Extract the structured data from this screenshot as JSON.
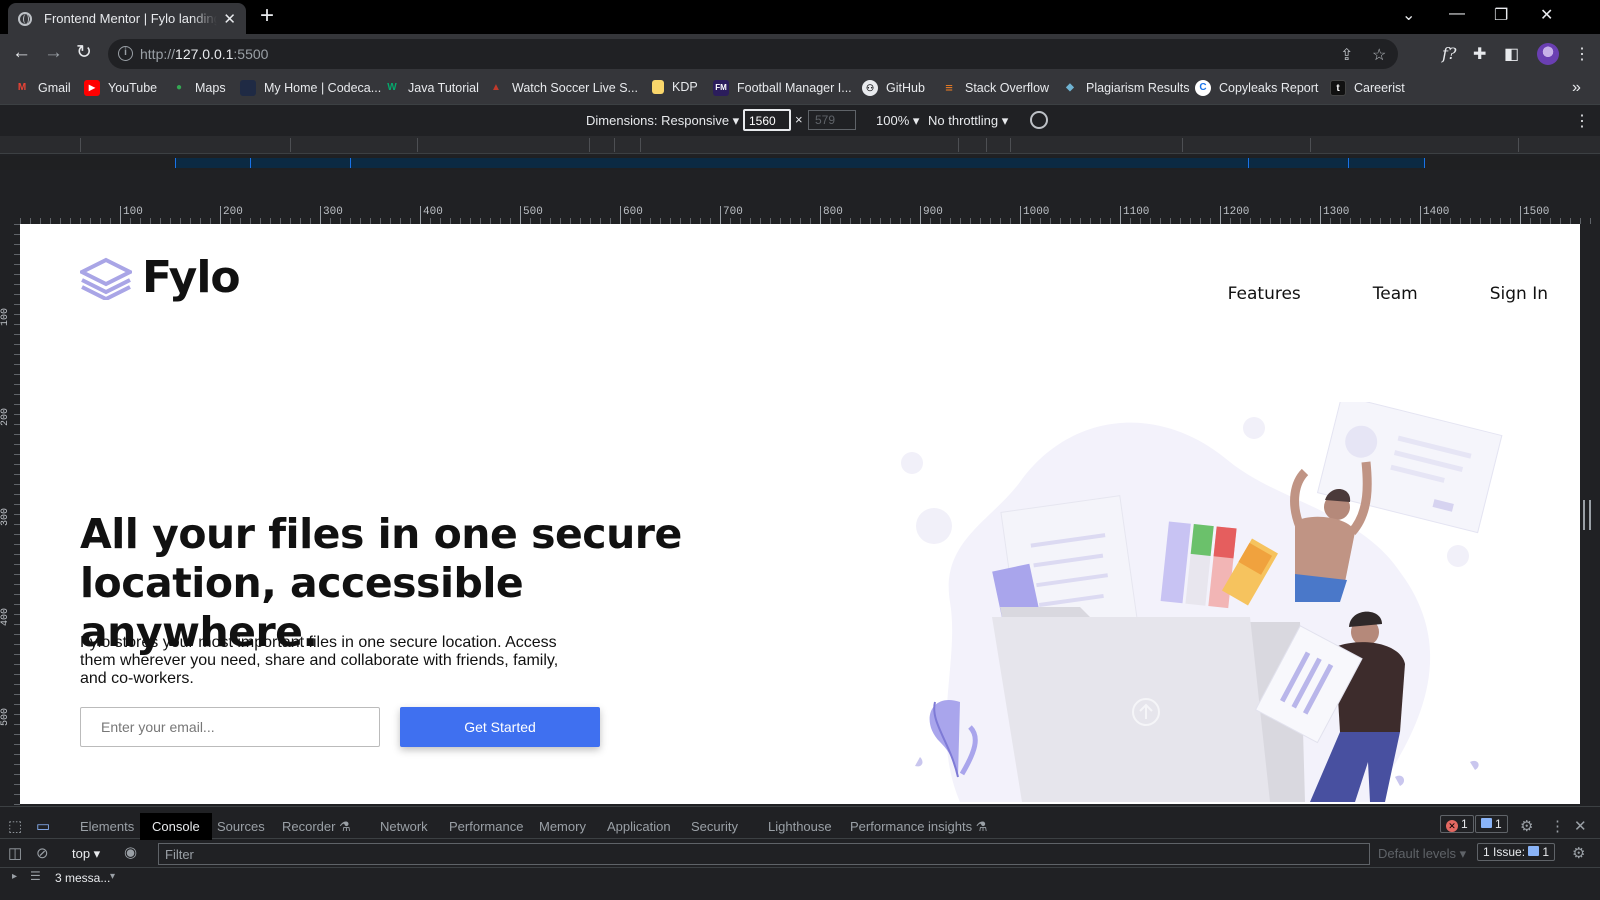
{
  "browser": {
    "tab_title": "Frontend Mentor | Fylo landing p",
    "url_prefix": "http://",
    "url_host": "127.0.0.1",
    "url_suffix": ":5500",
    "bookmarks": [
      {
        "label": "Gmail",
        "icon": "gmail-icon",
        "color": "#ea4335",
        "glyph": "M"
      },
      {
        "label": "YouTube",
        "icon": "youtube-icon",
        "color": "#ff0000",
        "glyph": "▶"
      },
      {
        "label": "Maps",
        "icon": "maps-icon",
        "color": "#34a853",
        "glyph": "●"
      },
      {
        "label": "My Home | Codeca...",
        "icon": "codecademy-icon",
        "color": "#1f2a44",
        "glyph": ""
      },
      {
        "label": "Java Tutorial",
        "icon": "w3schools-icon",
        "color": "#04aa6d",
        "glyph": "W"
      },
      {
        "label": "Watch Soccer Live S...",
        "icon": "soccer-icon",
        "color": "#c0392b",
        "glyph": "▲"
      },
      {
        "label": "KDP",
        "icon": "folder-icon",
        "color": "#f9d66b",
        "glyph": ""
      },
      {
        "label": "Football Manager I...",
        "icon": "fm-icon",
        "color": "#2b1d5c",
        "glyph": "FM"
      },
      {
        "label": "GitHub",
        "icon": "github-icon",
        "color": "#e8eaed",
        "glyph": "●"
      },
      {
        "label": "Stack Overflow",
        "icon": "stackoverflow-icon",
        "color": "#f48024",
        "glyph": "≡"
      },
      {
        "label": "Plagiarism Results",
        "icon": "plagiarism-icon",
        "color": "#6fb3d2",
        "glyph": "◆"
      },
      {
        "label": "Copyleaks Report",
        "icon": "copyleaks-icon",
        "color": "#1a73e8",
        "glyph": "C"
      },
      {
        "label": "Careerist",
        "icon": "careerist-icon",
        "color": "#111111",
        "glyph": "t"
      }
    ]
  },
  "device_toolbar": {
    "dimensions_label": "Dimensions: Responsive ▾",
    "width": "1560",
    "height": "579",
    "times": "×",
    "zoom": "100% ▾",
    "throttling": "No throttling ▾"
  },
  "rulers": {
    "h_marks": [
      "100",
      "200",
      "300",
      "400",
      "500",
      "600",
      "700",
      "800",
      "900",
      "1000",
      "1100",
      "1200",
      "1300",
      "1400",
      "1500"
    ],
    "v_marks": [
      "100",
      "200",
      "300",
      "400",
      "500"
    ]
  },
  "page": {
    "logo_text": "Fylo",
    "nav": [
      "Features",
      "Team",
      "Sign In"
    ],
    "hero_title": "All your files in one secure location, accessible anywhere.",
    "hero_text": "Fylo stores your most important files in one secure location. Access them wherever you need, share and collaborate with friends, family, and co-workers.",
    "email_placeholder": "Enter your email...",
    "cta_label": "Get Started",
    "accent": "#3f70f0"
  },
  "devtools": {
    "tabs": [
      "Elements",
      "Console",
      "Sources",
      "Recorder ⚗",
      "Network",
      "Performance",
      "Memory",
      "Application",
      "Security",
      "Lighthouse",
      "Performance insights ⚗"
    ],
    "active_tab": "Console",
    "error_count": "1",
    "message_count": "1",
    "context": "top ▾",
    "filter_placeholder": "Filter",
    "levels": "Default levels ▾",
    "issues": "1 Issue:",
    "issues_count": "1",
    "messages_summary": "3 messa..."
  }
}
